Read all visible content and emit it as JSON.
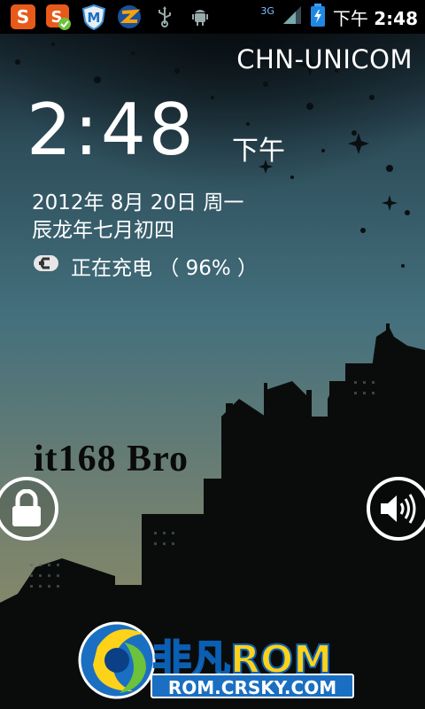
{
  "status_bar": {
    "left_icons": [
      "sogou-s-icon",
      "sogou-s-check-icon",
      "security-shield-m-icon",
      "flash-z-icon",
      "usb-icon",
      "android-debug-icon"
    ],
    "network_label": "3G",
    "ampm": "下午",
    "time": "2:48",
    "battery_level": 0.96
  },
  "lockscreen": {
    "carrier": "CHN-UNICOM",
    "clock": "2:48",
    "ampm": "下午",
    "date": "2012年 8月 20日 周一",
    "lunar_date": "辰龙年七月初四",
    "charging_text": "正在充电 （ 96% ）",
    "watermark": "it168  Bro"
  },
  "brand": {
    "name_cn": "非凡",
    "name_rom": "ROM",
    "url": "ROM.CRSKY.COM"
  },
  "colors": {
    "sky_top": "#0b1218",
    "sky_mid": "#3f6a78",
    "sky_bottom": "#8a8a62",
    "silhouette": "#0a0c0c",
    "brand_blue": "#1b6fc2",
    "brand_yellow": "#ffd21a"
  }
}
